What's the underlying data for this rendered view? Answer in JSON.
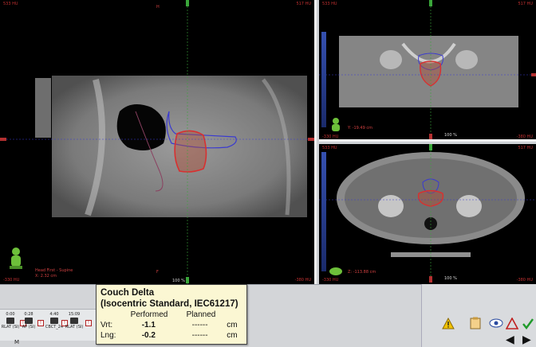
{
  "views": {
    "sagittal": {
      "hu_left": "533 HU",
      "hu_right": "517 HU",
      "top_label": "H",
      "bottom_label": "F",
      "orientation": "Head First - Supine",
      "coord": "X: 2.32 cm",
      "zoom": "100 %",
      "hu_bottom_left": "-330 HU",
      "hu_bottom_right": "-380 HU"
    },
    "coronal": {
      "hu_left": "533 HU",
      "hu_right": "517 HU",
      "coord": "Y: -19.49 cm",
      "zoom": "100 %",
      "hu_bottom_left": "-330 HU",
      "hu_bottom_right": "-380 HU"
    },
    "axial": {
      "hu_left": "533 HU",
      "hu_right": "517 HU",
      "coord": "Z: -113.88 cm",
      "zoom": "100 %",
      "hu_bottom_left": "-330 HU",
      "hu_bottom_right": "-380 HU"
    }
  },
  "timeline": [
    {
      "time": "0:00",
      "label": "RLAT (SI)"
    },
    {
      "time": "0:28",
      "label": "AP (SI)"
    },
    {
      "time": "4:40",
      "label": "CBCT_24"
    },
    {
      "time": "15:09",
      "label": "RLAT (SI)"
    }
  ],
  "timeline_marker": "M",
  "tooltip": {
    "title_line1": "Couch Delta",
    "title_line2": "(Isocentric Standard, IEC61217)",
    "col_performed": "Performed",
    "col_planned": "Planned",
    "rows": [
      {
        "label": "Vrt:",
        "performed": "-1.1",
        "planned": "------",
        "unit": "cm"
      },
      {
        "label": "Lng:",
        "performed": "-0.2",
        "planned": "------",
        "unit": "cm"
      }
    ]
  },
  "icons": [
    "warning-icon",
    "document-icon",
    "eye-icon",
    "delta-icon",
    "check-icon",
    "arrow-left-icon",
    "arrow-right-icon"
  ],
  "colors": {
    "hu_text": "#c03030",
    "contour_red": "#d83030",
    "contour_blue": "#3a3ad0",
    "crosshair_green": "#3aa63a"
  }
}
